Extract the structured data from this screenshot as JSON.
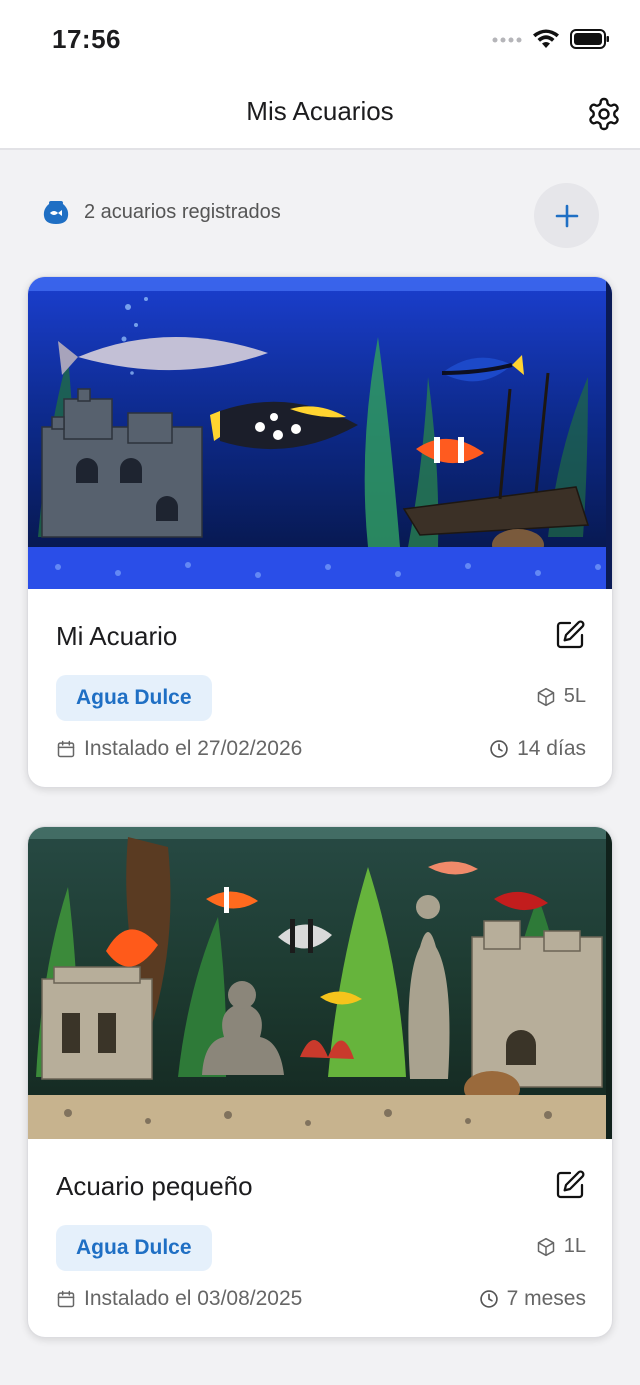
{
  "status_bar": {
    "time": "17:56"
  },
  "nav": {
    "title": "Mis Acuarios",
    "settings_icon": "gear-icon"
  },
  "summary": {
    "icon": "fishbowl-icon",
    "text": "2 acuarios registrados",
    "add_icon": "plus-icon"
  },
  "colors": {
    "accent": "#1f6fc4",
    "badge_bg": "#e5f0fb",
    "background": "#f2f2f4"
  },
  "aquariums": [
    {
      "name": "Mi Acuario",
      "water_type": "Agua Dulce",
      "volume": "5L",
      "installed": "Instalado el 27/02/2026",
      "age": "14 días",
      "image": "blue-lit aquarium with arowana, triggerfish, clownfish, blue tang, castle ruins and sunken ship"
    },
    {
      "name": "Acuario pequeño",
      "water_type": "Agua Dulce",
      "volume": "1L",
      "installed": "Instalado el 03/08/2025",
      "age": "7 meses",
      "image": "planted aquarium with discus, angelfish, clownfish, buddha statue, greek statue and castle ruins"
    }
  ]
}
